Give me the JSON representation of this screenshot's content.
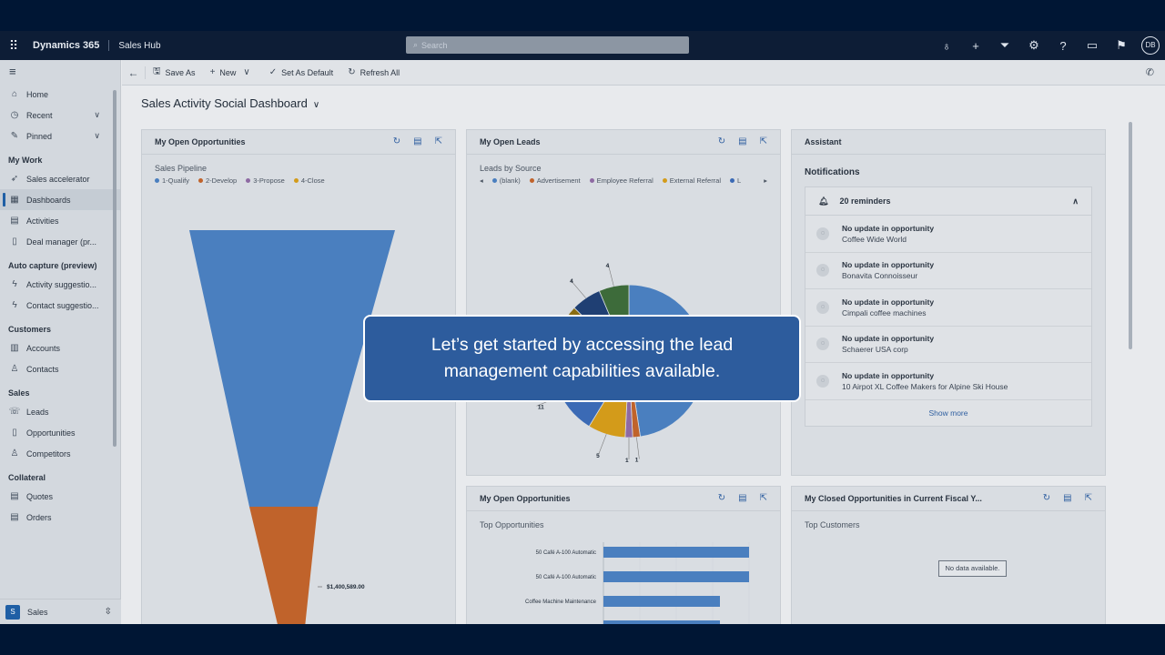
{
  "topbar": {
    "brand": "Dynamics 365",
    "app": "Sales Hub",
    "search_placeholder": "Search",
    "avatar": "DB"
  },
  "sidebar": {
    "items_top": [
      {
        "label": "Home",
        "icon": "home-icon",
        "glyph": "⌂"
      },
      {
        "label": "Recent",
        "icon": "clock-icon",
        "glyph": "◷",
        "chevron": "∨"
      },
      {
        "label": "Pinned",
        "icon": "pin-icon",
        "glyph": "✎",
        "chevron": "∨"
      }
    ],
    "groups": [
      {
        "title": "My Work",
        "items": [
          {
            "label": "Sales accelerator",
            "icon": "rocket-icon",
            "glyph": "➶"
          },
          {
            "label": "Dashboards",
            "icon": "dashboard-icon",
            "glyph": "▦",
            "active": true
          },
          {
            "label": "Activities",
            "icon": "calendar-icon",
            "glyph": "▤"
          },
          {
            "label": "Deal manager (pr...",
            "icon": "document-icon",
            "glyph": "▯"
          }
        ]
      },
      {
        "title": "Auto capture (preview)",
        "items": [
          {
            "label": "Activity suggestio...",
            "icon": "lightning-icon",
            "glyph": "ϟ"
          },
          {
            "label": "Contact suggestio...",
            "icon": "lightning-icon",
            "glyph": "ϟ"
          }
        ]
      },
      {
        "title": "Customers",
        "items": [
          {
            "label": "Accounts",
            "icon": "building-icon",
            "glyph": "▥"
          },
          {
            "label": "Contacts",
            "icon": "person-icon",
            "glyph": "♙"
          }
        ]
      },
      {
        "title": "Sales",
        "items": [
          {
            "label": "Leads",
            "icon": "phone-person-icon",
            "glyph": "☏"
          },
          {
            "label": "Opportunities",
            "icon": "document-icon",
            "glyph": "▯"
          },
          {
            "label": "Competitors",
            "icon": "person-icon",
            "glyph": "♙"
          }
        ]
      },
      {
        "title": "Collateral",
        "items": [
          {
            "label": "Quotes",
            "icon": "document-icon",
            "glyph": "▤"
          },
          {
            "label": "Orders",
            "icon": "document-icon",
            "glyph": "▤"
          }
        ]
      }
    ],
    "area": {
      "badge": "S",
      "label": "Sales"
    }
  },
  "cmdbar": {
    "save_as": "Save As",
    "new": "New",
    "set_default": "Set As Default",
    "refresh_all": "Refresh All"
  },
  "dashboard_title": "Sales Activity Social Dashboard",
  "cards": {
    "opps": {
      "title": "My Open Opportunities",
      "subtitle": "Sales Pipeline"
    },
    "leads": {
      "title": "My Open Leads",
      "subtitle": "Leads by Source"
    },
    "assistant": {
      "title": "Assistant"
    },
    "top_opps": {
      "title": "My Open Opportunities",
      "subtitle": "Top Opportunities"
    },
    "closed": {
      "title": "My Closed Opportunities in Current Fiscal Y...",
      "subtitle": "Top Customers",
      "no_data": "No data available."
    }
  },
  "chart_data": [
    {
      "type": "funnel",
      "title": "Sales Pipeline",
      "categories": [
        "1-Qualify",
        "2-Develop",
        "3-Propose",
        "4-Close"
      ],
      "colors": [
        "#4a7fbf",
        "#c0632b",
        "#8e6aa3",
        "#d39b1a"
      ],
      "data_labels": [
        "",
        "$1,400,589.00",
        "",
        ""
      ]
    },
    {
      "type": "pie",
      "title": "Leads by Source",
      "legend": [
        "(blank)",
        "Advertisement",
        "Employee Referral",
        "External Referral",
        "L"
      ],
      "legend_colors": [
        "#4a7fbf",
        "#c0632b",
        "#8e6aa3",
        "#d39b1a",
        "#3b6ab5"
      ],
      "slices": [
        {
          "value": 30,
          "color": "#4a7fbf",
          "label": ""
        },
        {
          "value": 1,
          "color": "#c0632b",
          "label": "1"
        },
        {
          "value": 1,
          "color": "#8e6aa3",
          "label": "1"
        },
        {
          "value": 5,
          "color": "#d39b1a",
          "label": "5"
        },
        {
          "value": 11,
          "color": "#3b6ab5",
          "label": "11"
        },
        {
          "value": 7,
          "color": "#8a6d12",
          "label": "7"
        },
        {
          "value": 4,
          "color": "#1f3f73",
          "label": "4"
        },
        {
          "value": 4,
          "color": "#3d6b3a",
          "label": "4"
        }
      ]
    },
    {
      "type": "bar",
      "title": "Top Opportunities",
      "categories": [
        "50 Café A-100 Automatic",
        "50 Café A-100 Automatic",
        "Coffee Machine Maintenance",
        ""
      ],
      "values": [
        100,
        100,
        80,
        80
      ],
      "color": "#4a7fbf"
    }
  ],
  "notifications": {
    "title": "Notifications",
    "count_label": "20 reminders",
    "items": [
      {
        "title": "No update in opportunity",
        "subtitle": "Coffee Wide World"
      },
      {
        "title": "No update in opportunity",
        "subtitle": "Bonavita Connoisseur"
      },
      {
        "title": "No update in opportunity",
        "subtitle": "Cimpali coffee machines"
      },
      {
        "title": "No update in opportunity",
        "subtitle": "Schaerer USA corp"
      },
      {
        "title": "No update in opportunity",
        "subtitle": "10 Airpot XL Coffee Makers for Alpine Ski House"
      }
    ],
    "show_more": "Show more"
  },
  "overlay_text": "Let’s get started by accessing the lead management capabilities available."
}
